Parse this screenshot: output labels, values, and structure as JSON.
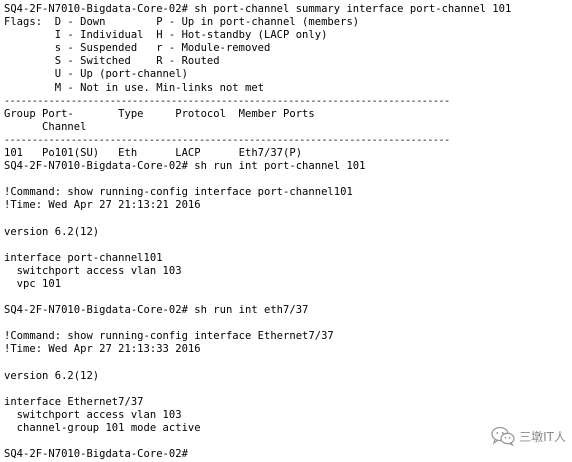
{
  "terminal": {
    "lines": [
      "SQ4-2F-N7010-Bigdata-Core-02# sh port-channel summary interface port-channel 101",
      "Flags:  D - Down        P - Up in port-channel (members)",
      "        I - Individual  H - Hot-standby (LACP only)",
      "        s - Suspended   r - Module-removed",
      "        S - Switched    R - Routed",
      "        U - Up (port-channel)",
      "        M - Not in use. Min-links not met",
      "--------------------------------------------------------------------------------",
      "Group Port-       Type     Protocol  Member Ports",
      "      Channel",
      "--------------------------------------------------------------------------------",
      "101   Po101(SU)   Eth      LACP      Eth7/37(P)",
      "SQ4-2F-N7010-Bigdata-Core-02# sh run int port-channel 101",
      "",
      "!Command: show running-config interface port-channel101",
      "!Time: Wed Apr 27 21:13:21 2016",
      "",
      "version 6.2(12)",
      "",
      "interface port-channel101",
      "  switchport access vlan 103",
      "  vpc 101",
      "",
      "SQ4-2F-N7010-Bigdata-Core-02# sh run int eth7/37",
      "",
      "!Command: show running-config interface Ethernet7/37",
      "!Time: Wed Apr 27 21:13:33 2016",
      "",
      "version 6.2(12)",
      "",
      "interface Ethernet7/37",
      "  switchport access vlan 103",
      "  channel-group 101 mode active",
      "",
      "SQ4-2F-N7010-Bigdata-Core-02#"
    ]
  },
  "watermark": {
    "text": "三墩IT人",
    "icon": "wechat-icon"
  },
  "colors": {
    "background": "#ffffff",
    "text": "#000000",
    "watermark": "#8a8a8a"
  }
}
